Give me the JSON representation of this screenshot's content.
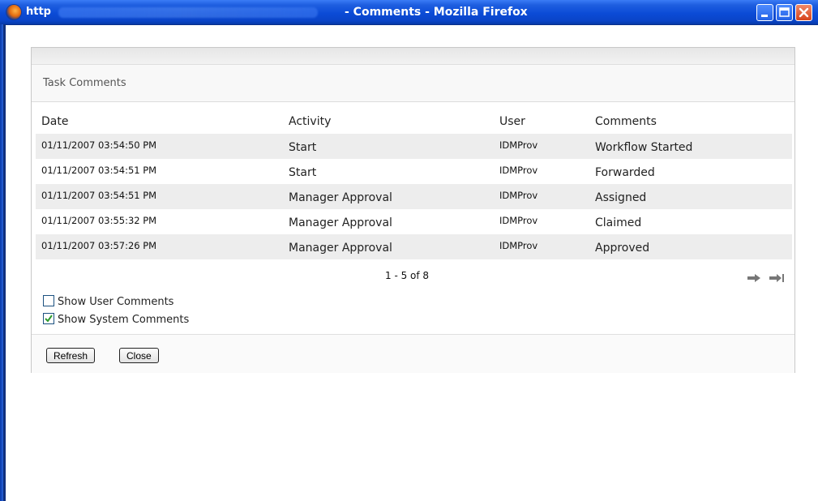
{
  "window": {
    "url_fragment": "http",
    "title": "- Comments - Mozilla Firefox"
  },
  "panel": {
    "title": "Task Comments"
  },
  "table": {
    "headers": [
      "Date",
      "Activity",
      "User",
      "Comments"
    ],
    "rows": [
      {
        "date": "01/11/2007 03:54:50 PM",
        "activity": "Start",
        "user": "IDMProv",
        "comment": "Workflow Started"
      },
      {
        "date": "01/11/2007 03:54:51 PM",
        "activity": "Start",
        "user": "IDMProv",
        "comment": "Forwarded"
      },
      {
        "date": "01/11/2007 03:54:51 PM",
        "activity": "Manager Approval",
        "user": "IDMProv",
        "comment": "Assigned"
      },
      {
        "date": "01/11/2007 03:55:32 PM",
        "activity": "Manager Approval",
        "user": "IDMProv",
        "comment": "Claimed"
      },
      {
        "date": "01/11/2007 03:57:26 PM",
        "activity": "Manager Approval",
        "user": "IDMProv",
        "comment": "Approved"
      }
    ]
  },
  "pager": {
    "text": "1 - 5 of 8",
    "icons": [
      "next-arrow-icon",
      "last-page-icon"
    ]
  },
  "options": {
    "show_user_comments": {
      "label": "Show User Comments",
      "checked": false
    },
    "show_system_comments": {
      "label": "Show System Comments",
      "checked": true
    }
  },
  "buttons": {
    "refresh": "Refresh",
    "close": "Close"
  },
  "colors": {
    "titlebar": "#0b4bd6",
    "row_alt": "#ededed",
    "checkbox_check": "#2e9a2e"
  }
}
